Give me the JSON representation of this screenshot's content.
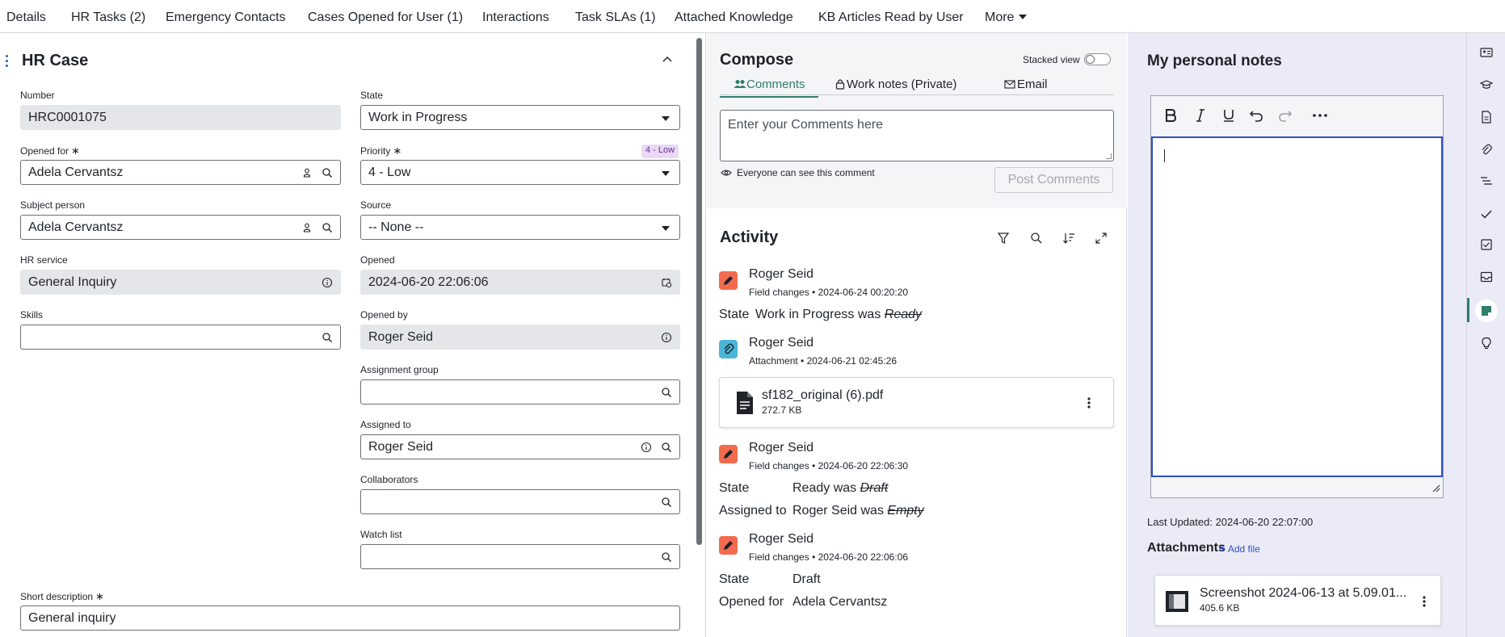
{
  "tabs": [
    {
      "label": "Details"
    },
    {
      "label": "HR Tasks (2)"
    },
    {
      "label": "Emergency Contacts"
    },
    {
      "label": "Cases Opened for User (1)"
    },
    {
      "label": "Interactions"
    },
    {
      "label": "Task SLAs (1)"
    },
    {
      "label": "Attached Knowledge"
    },
    {
      "label": "KB Articles Read by User"
    },
    {
      "label": "More"
    }
  ],
  "form": {
    "title": "HR Case",
    "number": {
      "label": "Number",
      "value": "HRC0001075"
    },
    "state": {
      "label": "State",
      "value": "Work in Progress"
    },
    "opened_for": {
      "label": "Opened for",
      "value": "Adela Cervantsz"
    },
    "priority": {
      "label": "Priority",
      "value": "4 - Low",
      "badge": "4 - Low"
    },
    "subject_person": {
      "label": "Subject person",
      "value": "Adela Cervantsz"
    },
    "source": {
      "label": "Source",
      "value": "-- None --"
    },
    "hr_service": {
      "label": "HR service",
      "value": "General Inquiry"
    },
    "opened": {
      "label": "Opened",
      "value": "2024-06-20 22:06:06"
    },
    "skills": {
      "label": "Skills",
      "value": ""
    },
    "opened_by": {
      "label": "Opened by",
      "value": "Roger Seid"
    },
    "assignment_group": {
      "label": "Assignment group",
      "value": ""
    },
    "assigned_to": {
      "label": "Assigned to",
      "value": "Roger Seid"
    },
    "collaborators": {
      "label": "Collaborators",
      "value": ""
    },
    "watch_list": {
      "label": "Watch list",
      "value": ""
    },
    "short_description": {
      "label": "Short description",
      "value": "General inquiry"
    },
    "required_mark": "∗"
  },
  "compose": {
    "title": "Compose",
    "stacked_view_label": "Stacked view",
    "tabs": [
      {
        "label": "Comments"
      },
      {
        "label": "Work notes (Private)"
      },
      {
        "label": "Email"
      }
    ],
    "placeholder": "Enter your Comments here",
    "visibility_note": "Everyone can see this comment",
    "post_button": "Post Comments"
  },
  "activity": {
    "title": "Activity",
    "entries": [
      {
        "user": "Roger Seid",
        "type": "Field changes",
        "time": "2024-06-24 00:20:20",
        "changes": [
          {
            "field": "State",
            "new": "Work in Progress",
            "was": "was",
            "old": "Ready"
          }
        ]
      },
      {
        "user": "Roger Seid",
        "type": "Attachment",
        "time": "2024-06-21 02:45:26",
        "file": {
          "name": "sf182_original (6).pdf",
          "size": "272.7 KB"
        }
      },
      {
        "user": "Roger Seid",
        "type": "Field changes",
        "time": "2024-06-20 22:06:30",
        "changes": [
          {
            "field": "State",
            "new": "Ready",
            "was": "was",
            "old": "Draft"
          },
          {
            "field": "Assigned to",
            "new": "Roger Seid",
            "was": "was",
            "old": "Empty"
          }
        ]
      },
      {
        "user": "Roger Seid",
        "type": "Field changes",
        "time": "2024-06-20 22:06:06",
        "changes": [
          {
            "field": "State",
            "new": "Draft"
          },
          {
            "field": "Opened for",
            "new": "Adela Cervantsz"
          }
        ]
      }
    ],
    "separator": "•"
  },
  "notes": {
    "title": "My personal notes",
    "last_updated_label": "Last Updated:",
    "last_updated": "2024-06-20 22:07:00",
    "attachments_label": "Attachments",
    "add_file_label": "Add file",
    "file": {
      "name": "Screenshot 2024-06-13 at 5.09.01...",
      "size": "405.6 KB"
    }
  },
  "colors": {
    "accent": "#2f7d6d",
    "edit_icon": "#f26b4f",
    "attach_icon": "#4ab5d8",
    "notes_bg": "#ebebf8"
  }
}
